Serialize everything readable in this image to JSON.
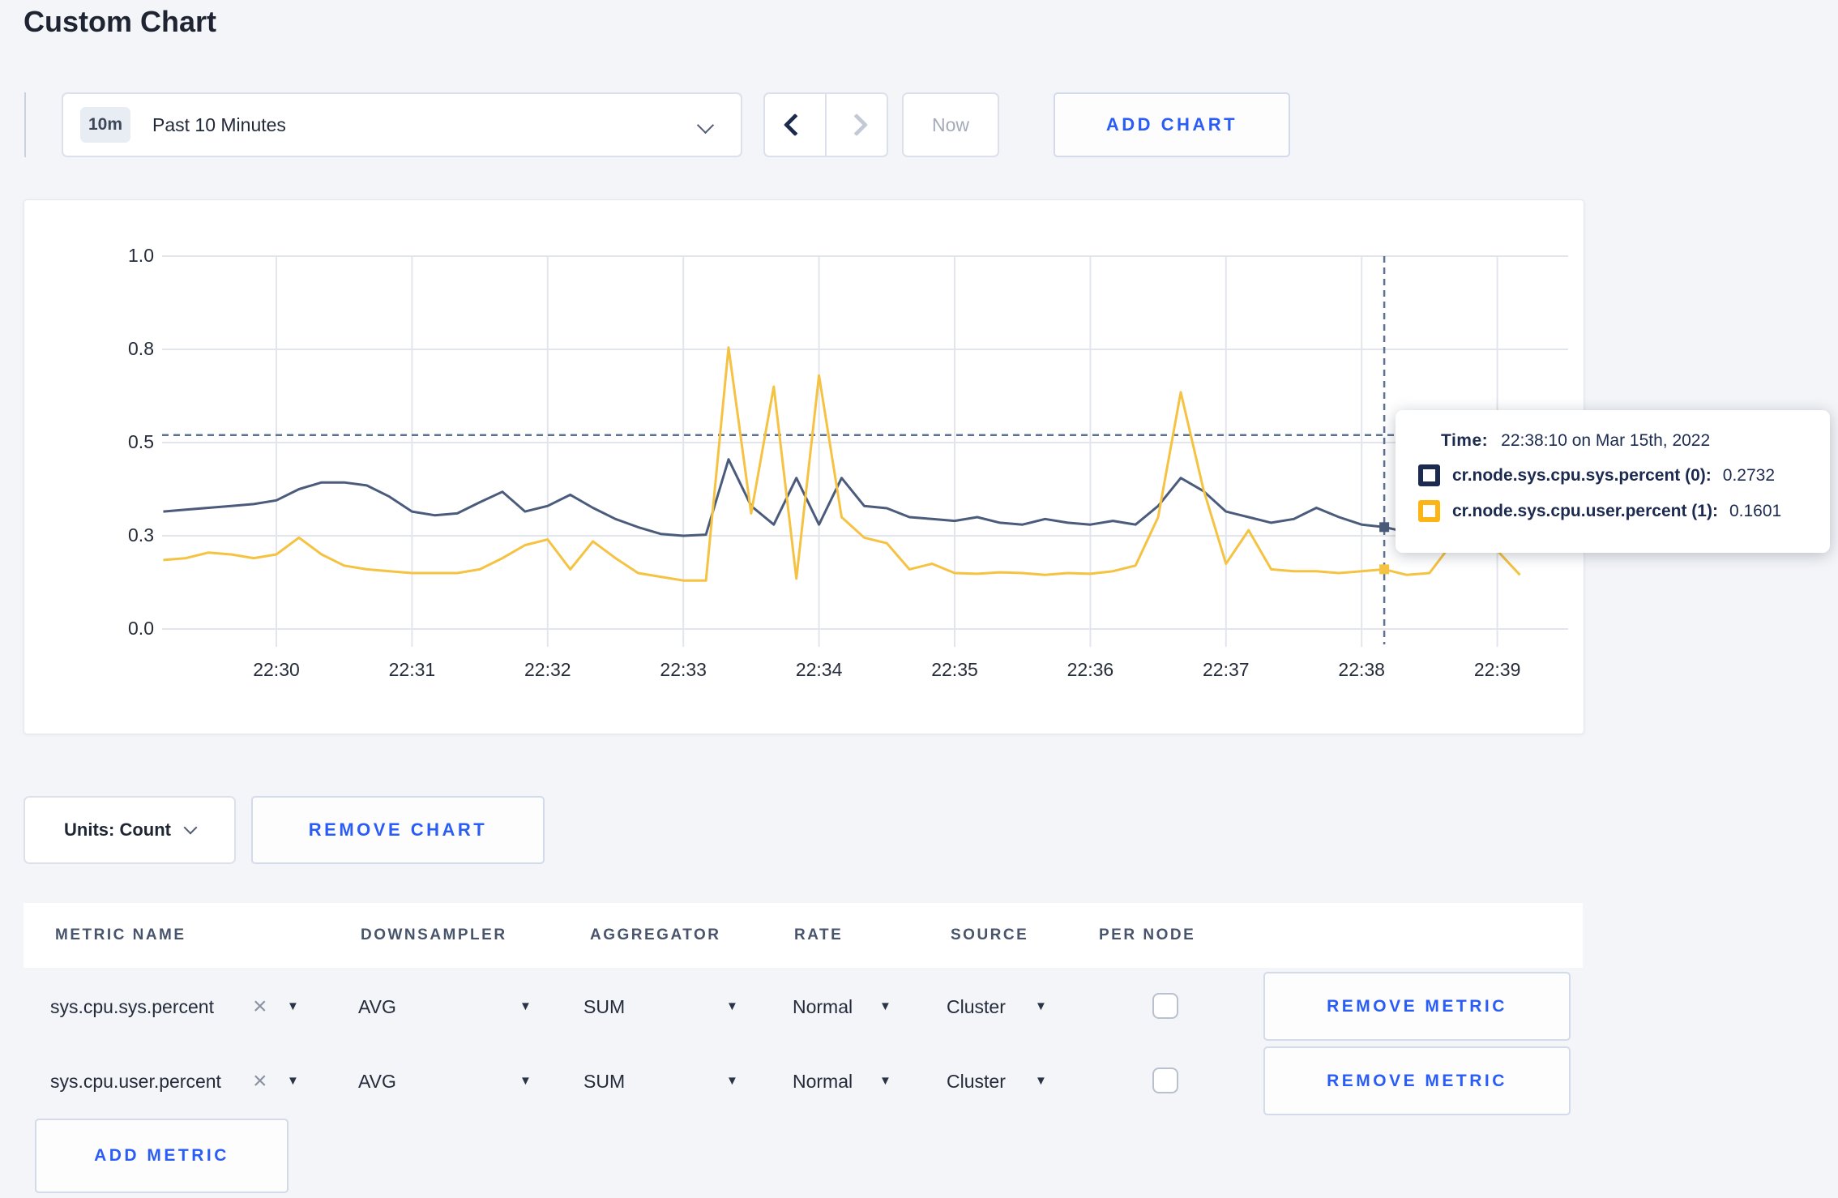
{
  "page": {
    "title": "Custom Chart"
  },
  "toolbar": {
    "time_window": {
      "badge": "10m",
      "label": "Past 10 Minutes"
    },
    "now_label": "Now",
    "add_chart_label": "ADD CHART"
  },
  "chart": {
    "tooltip": {
      "time_label": "Time:",
      "time_value": "22:38:10 on Mar 15th, 2022",
      "series": [
        {
          "name": "cr.node.sys.cpu.sys.percent (0):",
          "value": "0.2732",
          "swatch_color": "#1b2a4e"
        },
        {
          "name": "cr.node.sys.cpu.user.percent (1):",
          "value": "0.1601",
          "swatch_color": "#fdb515"
        }
      ]
    }
  },
  "chart_data": {
    "type": "line",
    "title": "",
    "xlabel": "",
    "ylabel": "",
    "ylim": [
      0,
      1
    ],
    "grid": true,
    "x_tick_labels": [
      "22:30",
      "22:31",
      "22:32",
      "22:33",
      "22:34",
      "22:35",
      "22:36",
      "22:37",
      "22:38",
      "22:39"
    ],
    "y_ticks": [
      {
        "value": 0.0,
        "label": "0.0"
      },
      {
        "value": 0.25,
        "label": "0.3"
      },
      {
        "value": 0.5,
        "label": "0.5"
      },
      {
        "value": 0.75,
        "label": "0.8"
      },
      {
        "value": 1.0,
        "label": "1.0"
      }
    ],
    "t0_seconds": -50,
    "dt_seconds": 10,
    "series": [
      {
        "name": "cr.node.sys.cpu.sys.percent",
        "color": "#4a5b7c",
        "values": [
          0.315,
          0.32,
          0.325,
          0.33,
          0.335,
          0.345,
          0.375,
          0.393,
          0.393,
          0.385,
          0.355,
          0.315,
          0.305,
          0.31,
          0.34,
          0.368,
          0.315,
          0.33,
          0.36,
          0.325,
          0.295,
          0.273,
          0.255,
          0.25,
          0.253,
          0.455,
          0.33,
          0.28,
          0.405,
          0.28,
          0.405,
          0.33,
          0.324,
          0.3,
          0.295,
          0.29,
          0.3,
          0.285,
          0.28,
          0.295,
          0.285,
          0.28,
          0.29,
          0.28,
          0.33,
          0.405,
          0.37,
          0.315,
          0.3,
          0.285,
          0.295,
          0.325,
          0.3,
          0.28,
          0.2732,
          0.26,
          0.285,
          0.295,
          0.3,
          0.3,
          0.3
        ]
      },
      {
        "name": "cr.node.sys.cpu.user.percent",
        "color": "#f5c242",
        "values": [
          0.185,
          0.19,
          0.205,
          0.2,
          0.19,
          0.2,
          0.245,
          0.2,
          0.17,
          0.16,
          0.155,
          0.15,
          0.15,
          0.15,
          0.16,
          0.19,
          0.225,
          0.24,
          0.16,
          0.235,
          0.19,
          0.15,
          0.14,
          0.13,
          0.13,
          0.755,
          0.31,
          0.65,
          0.135,
          0.68,
          0.3,
          0.245,
          0.23,
          0.16,
          0.175,
          0.15,
          0.148,
          0.152,
          0.15,
          0.145,
          0.15,
          0.148,
          0.155,
          0.17,
          0.3,
          0.635,
          0.375,
          0.175,
          0.265,
          0.16,
          0.155,
          0.155,
          0.15,
          0.155,
          0.1601,
          0.145,
          0.15,
          0.23,
          0.31,
          0.21,
          0.145
        ]
      }
    ],
    "hover": {
      "time": "22:38:10",
      "t_seconds": 490,
      "hline_value": 0.52,
      "markers": [
        {
          "series": 0,
          "value": 0.2732
        },
        {
          "series": 1,
          "value": 0.1601
        }
      ]
    }
  },
  "chart_footer": {
    "units_label": "Units: Count",
    "remove_chart_label": "REMOVE CHART"
  },
  "metrics_table": {
    "headers": [
      "METRIC NAME",
      "DOWNSAMPLER",
      "AGGREGATOR",
      "RATE",
      "SOURCE",
      "PER NODE"
    ],
    "rows": [
      {
        "metric": "sys.cpu.sys.percent",
        "downsampler": "AVG",
        "aggregator": "SUM",
        "rate": "Normal",
        "source": "Cluster",
        "per_node_checked": false,
        "remove_label": "REMOVE METRIC"
      },
      {
        "metric": "sys.cpu.user.percent",
        "downsampler": "AVG",
        "aggregator": "SUM",
        "rate": "Normal",
        "source": "Cluster",
        "per_node_checked": false,
        "remove_label": "REMOVE METRIC"
      }
    ],
    "add_metric_label": "ADD METRIC",
    "clear_icon": "×",
    "dropdown_icon": "▼"
  },
  "colors": {
    "accent_blue": "#2a5cf6",
    "grid": "#e2e6ec",
    "dashed_guide": "#5d7292",
    "page_background": "#f3f5f8"
  }
}
